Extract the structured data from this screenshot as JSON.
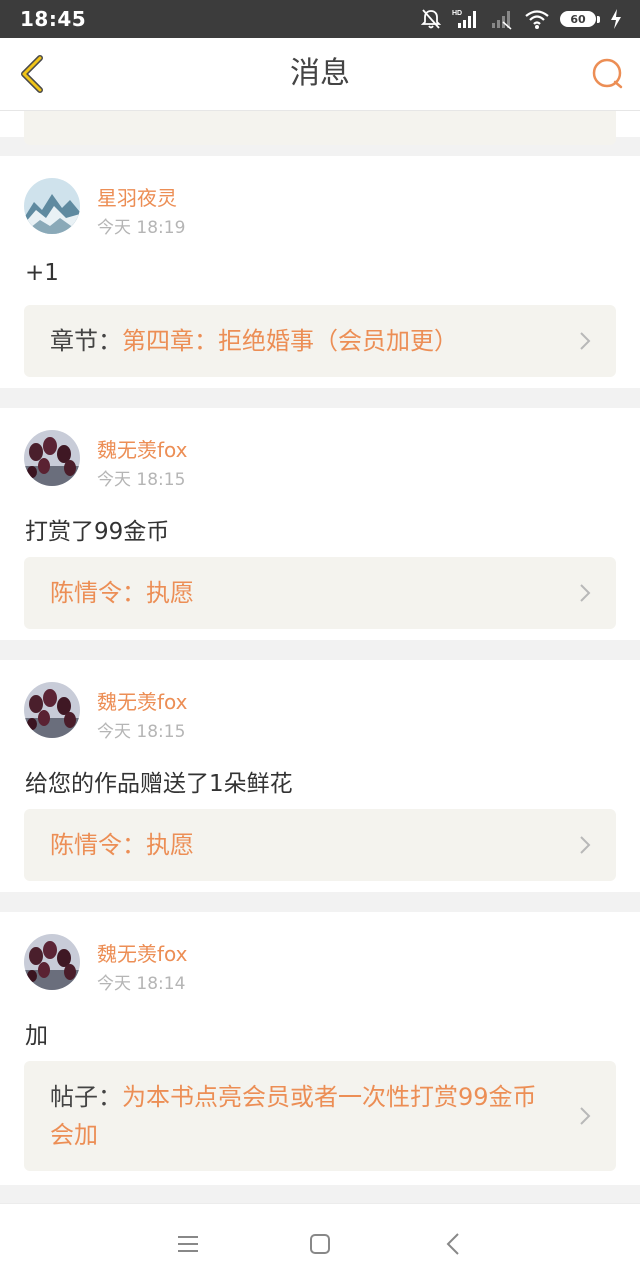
{
  "status_bar": {
    "time": "18:45",
    "battery": "60",
    "icons": [
      "bell-muted-icon",
      "signal-hd-icon",
      "signal-icon",
      "wifi-icon",
      "battery-icon",
      "charging-icon"
    ]
  },
  "header": {
    "title": "消息",
    "back_icon": "back-chevron-icon",
    "search_icon": "search-icon",
    "accent_color": "#ec8e55",
    "back_color": "#f0c419"
  },
  "messages": [
    {
      "username": "星羽夜灵",
      "time": "今天 18:19",
      "text": "+1",
      "ref_label": "章节：",
      "ref_value": "第四章：拒绝婚事（会员加更）",
      "avatar": "snowy-mountain-avatar"
    },
    {
      "username": "魏无羡fox",
      "time": "今天 18:15",
      "text": "打赏了99金币",
      "ref_label": "",
      "ref_value": "陈情令：执愿",
      "avatar": "tulips-avatar"
    },
    {
      "username": "魏无羡fox",
      "time": "今天 18:15",
      "text": "给您的作品赠送了1朵鲜花",
      "ref_label": "",
      "ref_value": "陈情令：执愿",
      "avatar": "tulips-avatar"
    },
    {
      "username": "魏无羡fox",
      "time": "今天 18:14",
      "text": "加",
      "ref_label": "帖子：",
      "ref_value": "为本书点亮会员或者一次性打赏99金币会加",
      "avatar": "tulips-avatar"
    }
  ],
  "nav_bar": {
    "buttons": [
      "menu-icon",
      "home-square-icon",
      "back-triangle-icon"
    ]
  }
}
